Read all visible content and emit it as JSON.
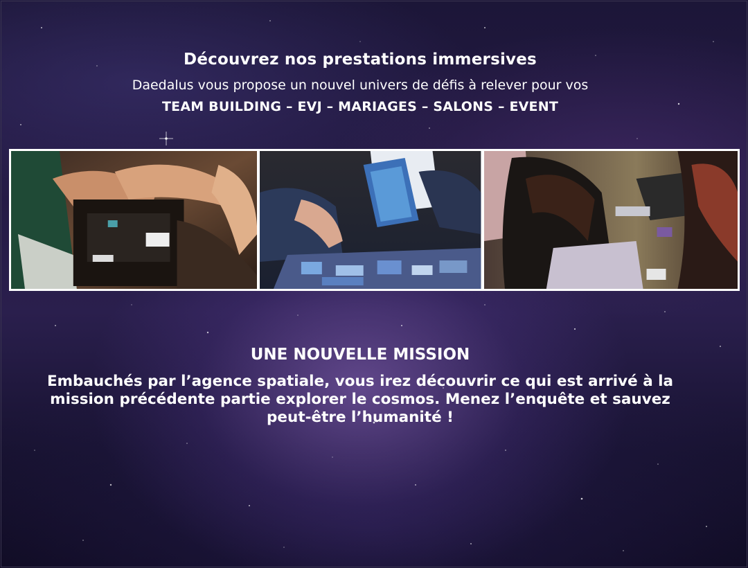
{
  "hero": {
    "title": "Découvrez nos prestations immersives",
    "subtitle": "Daedalus vous propose un nouvel univers de défis à relever pour vos",
    "tags": "TEAM BUILDING – EVJ – MARIAGES – SALONS – EVENT"
  },
  "gallery": {
    "photos": [
      "board-game-photo-1",
      "board-game-photo-2",
      "board-game-photo-3"
    ]
  },
  "mission": {
    "title": "UNE NOUVELLE MISSION",
    "text": "Embauchés par l’agence spatiale, vous irez découvrir ce qui est arrivé à la mission précédente partie explorer le cosmos. Menez l’enquête et sauvez peut-être l’humanité !"
  },
  "colors": {
    "text": "#ffffff",
    "background": "#241a44",
    "gallery_border": "#ffffff"
  }
}
